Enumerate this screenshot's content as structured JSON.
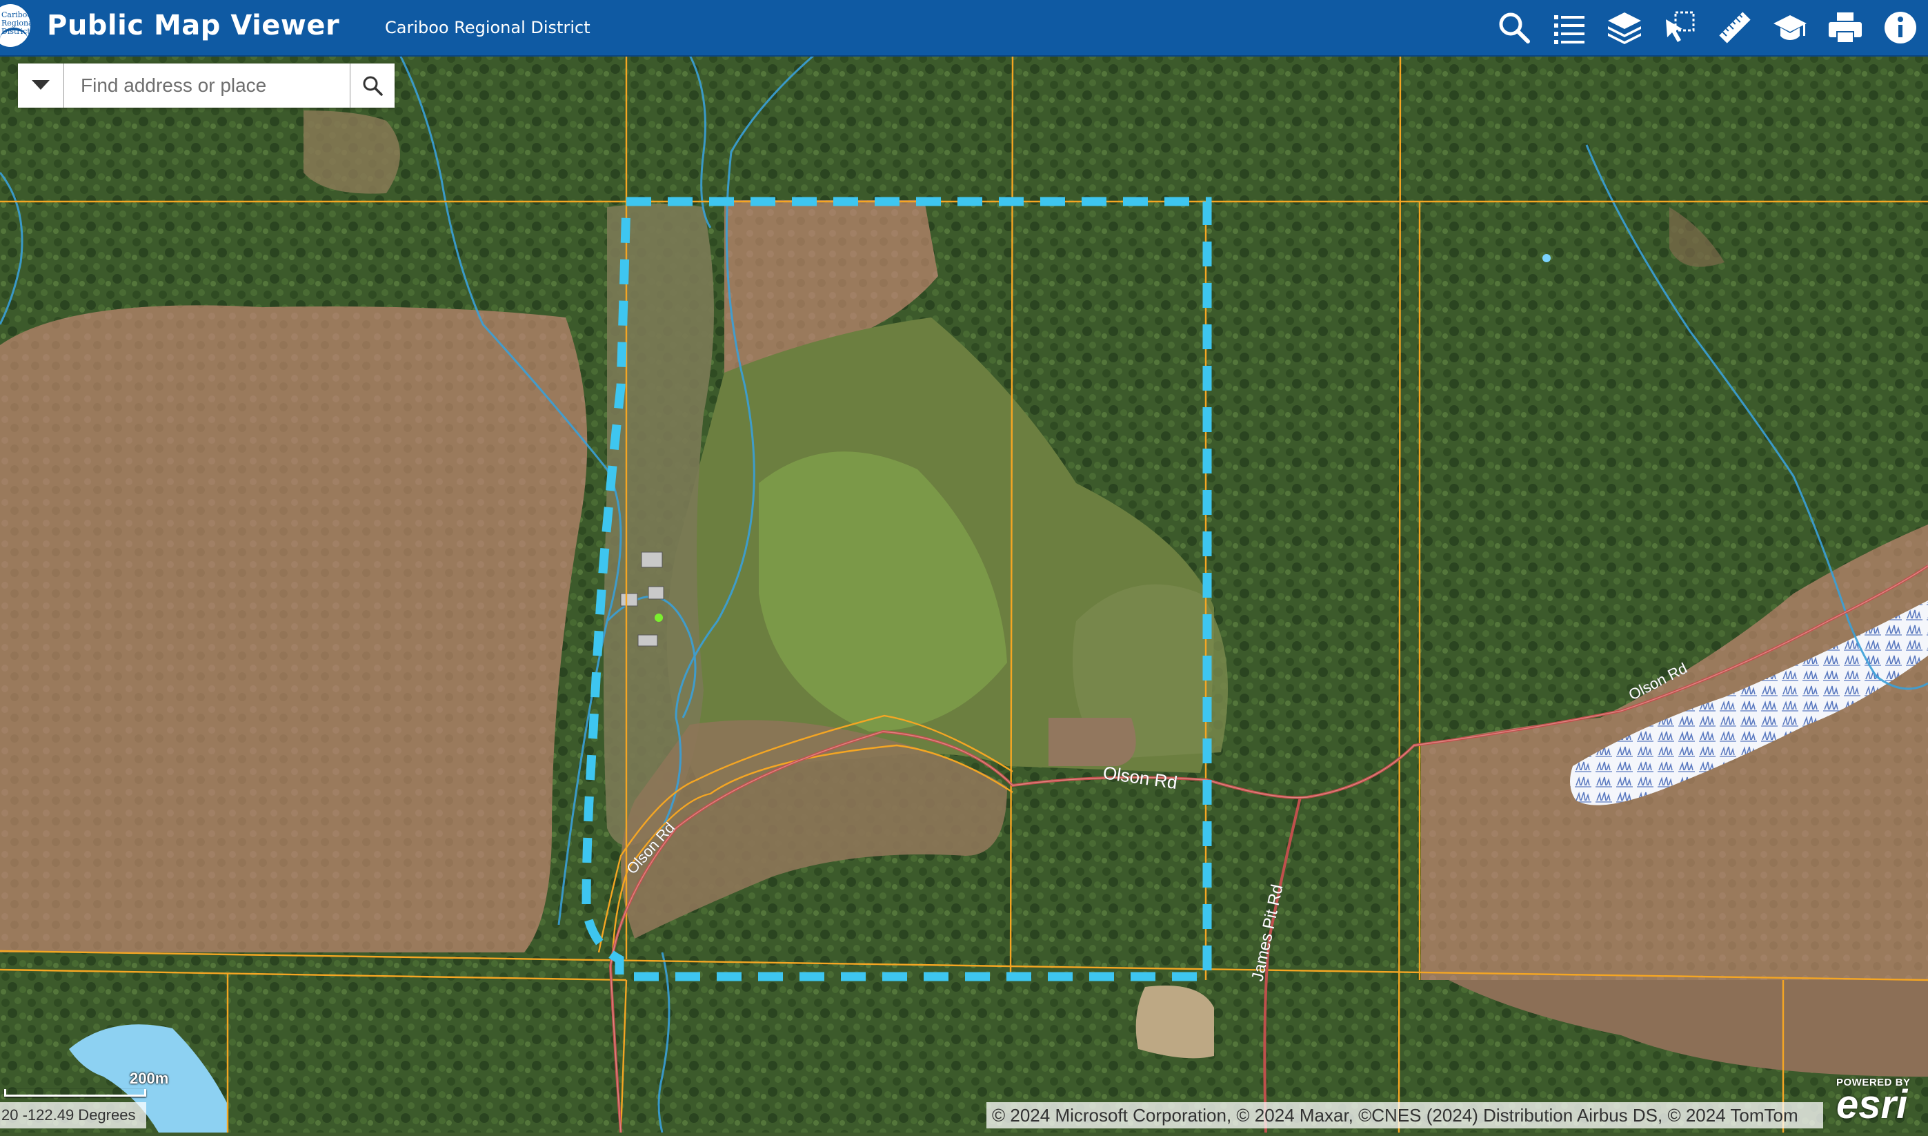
{
  "header": {
    "app_title": "Public Map Viewer",
    "district": "Cariboo Regional District",
    "logo_text": "Cariboo Regional District"
  },
  "toolbar": {
    "tools": [
      {
        "name": "search-tool",
        "icon": "search-icon"
      },
      {
        "name": "legend-tool",
        "icon": "list-icon"
      },
      {
        "name": "layers-tool",
        "icon": "layers-icon"
      },
      {
        "name": "identify-tool",
        "icon": "select-cursor-icon"
      },
      {
        "name": "measure-tool",
        "icon": "ruler-icon"
      },
      {
        "name": "tutorial-tool",
        "icon": "graduation-cap-icon"
      },
      {
        "name": "print-tool",
        "icon": "printer-icon"
      },
      {
        "name": "about-tool",
        "icon": "info-icon"
      }
    ]
  },
  "search": {
    "placeholder": "Find address or place"
  },
  "map": {
    "road_labels": {
      "olson_rd_1": "Olson Rd",
      "olson_rd_2": "Olson Rd",
      "olson_rd_3": "Olson Rd",
      "james_pit_rd": "James Pit Rd"
    },
    "scale_label": "200m",
    "coordinates": "20 -122.49 Degrees",
    "attribution": "© 2024 Microsoft Corporation, © 2024 Maxar, ©CNES (2024) Distribution Airbus DS, © 2024 TomTom",
    "esri_powered": "POWERED BY",
    "esri_word": "esri"
  },
  "colors": {
    "header_bg": "#0f5aa3",
    "parcel_line": "#f5a623",
    "selection_outline": "#3ec6f0",
    "road": "#c0504d",
    "stream": "#3aa0d8"
  }
}
